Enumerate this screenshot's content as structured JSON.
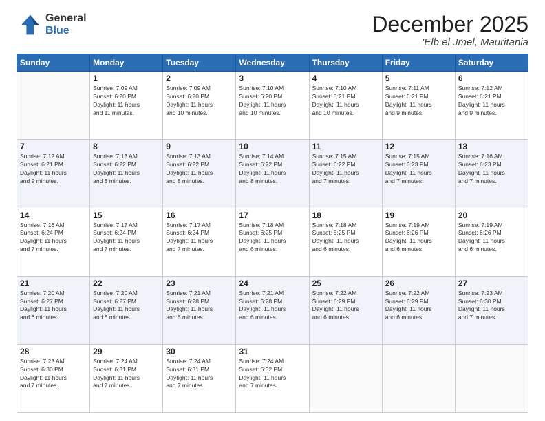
{
  "logo": {
    "general": "General",
    "blue": "Blue"
  },
  "title": "December 2025",
  "location": "'Elb el Jmel, Mauritania",
  "days_of_week": [
    "Sunday",
    "Monday",
    "Tuesday",
    "Wednesday",
    "Thursday",
    "Friday",
    "Saturday"
  ],
  "weeks": [
    [
      {
        "day": "",
        "info": ""
      },
      {
        "day": "1",
        "info": "Sunrise: 7:09 AM\nSunset: 6:20 PM\nDaylight: 11 hours\nand 11 minutes."
      },
      {
        "day": "2",
        "info": "Sunrise: 7:09 AM\nSunset: 6:20 PM\nDaylight: 11 hours\nand 10 minutes."
      },
      {
        "day": "3",
        "info": "Sunrise: 7:10 AM\nSunset: 6:20 PM\nDaylight: 11 hours\nand 10 minutes."
      },
      {
        "day": "4",
        "info": "Sunrise: 7:10 AM\nSunset: 6:21 PM\nDaylight: 11 hours\nand 10 minutes."
      },
      {
        "day": "5",
        "info": "Sunrise: 7:11 AM\nSunset: 6:21 PM\nDaylight: 11 hours\nand 9 minutes."
      },
      {
        "day": "6",
        "info": "Sunrise: 7:12 AM\nSunset: 6:21 PM\nDaylight: 11 hours\nand 9 minutes."
      }
    ],
    [
      {
        "day": "7",
        "info": "Sunrise: 7:12 AM\nSunset: 6:21 PM\nDaylight: 11 hours\nand 9 minutes."
      },
      {
        "day": "8",
        "info": "Sunrise: 7:13 AM\nSunset: 6:22 PM\nDaylight: 11 hours\nand 8 minutes."
      },
      {
        "day": "9",
        "info": "Sunrise: 7:13 AM\nSunset: 6:22 PM\nDaylight: 11 hours\nand 8 minutes."
      },
      {
        "day": "10",
        "info": "Sunrise: 7:14 AM\nSunset: 6:22 PM\nDaylight: 11 hours\nand 8 minutes."
      },
      {
        "day": "11",
        "info": "Sunrise: 7:15 AM\nSunset: 6:22 PM\nDaylight: 11 hours\nand 7 minutes."
      },
      {
        "day": "12",
        "info": "Sunrise: 7:15 AM\nSunset: 6:23 PM\nDaylight: 11 hours\nand 7 minutes."
      },
      {
        "day": "13",
        "info": "Sunrise: 7:16 AM\nSunset: 6:23 PM\nDaylight: 11 hours\nand 7 minutes."
      }
    ],
    [
      {
        "day": "14",
        "info": "Sunrise: 7:16 AM\nSunset: 6:24 PM\nDaylight: 11 hours\nand 7 minutes."
      },
      {
        "day": "15",
        "info": "Sunrise: 7:17 AM\nSunset: 6:24 PM\nDaylight: 11 hours\nand 7 minutes."
      },
      {
        "day": "16",
        "info": "Sunrise: 7:17 AM\nSunset: 6:24 PM\nDaylight: 11 hours\nand 7 minutes."
      },
      {
        "day": "17",
        "info": "Sunrise: 7:18 AM\nSunset: 6:25 PM\nDaylight: 11 hours\nand 6 minutes."
      },
      {
        "day": "18",
        "info": "Sunrise: 7:18 AM\nSunset: 6:25 PM\nDaylight: 11 hours\nand 6 minutes."
      },
      {
        "day": "19",
        "info": "Sunrise: 7:19 AM\nSunset: 6:26 PM\nDaylight: 11 hours\nand 6 minutes."
      },
      {
        "day": "20",
        "info": "Sunrise: 7:19 AM\nSunset: 6:26 PM\nDaylight: 11 hours\nand 6 minutes."
      }
    ],
    [
      {
        "day": "21",
        "info": "Sunrise: 7:20 AM\nSunset: 6:27 PM\nDaylight: 11 hours\nand 6 minutes."
      },
      {
        "day": "22",
        "info": "Sunrise: 7:20 AM\nSunset: 6:27 PM\nDaylight: 11 hours\nand 6 minutes."
      },
      {
        "day": "23",
        "info": "Sunrise: 7:21 AM\nSunset: 6:28 PM\nDaylight: 11 hours\nand 6 minutes."
      },
      {
        "day": "24",
        "info": "Sunrise: 7:21 AM\nSunset: 6:28 PM\nDaylight: 11 hours\nand 6 minutes."
      },
      {
        "day": "25",
        "info": "Sunrise: 7:22 AM\nSunset: 6:29 PM\nDaylight: 11 hours\nand 6 minutes."
      },
      {
        "day": "26",
        "info": "Sunrise: 7:22 AM\nSunset: 6:29 PM\nDaylight: 11 hours\nand 6 minutes."
      },
      {
        "day": "27",
        "info": "Sunrise: 7:23 AM\nSunset: 6:30 PM\nDaylight: 11 hours\nand 7 minutes."
      }
    ],
    [
      {
        "day": "28",
        "info": "Sunrise: 7:23 AM\nSunset: 6:30 PM\nDaylight: 11 hours\nand 7 minutes."
      },
      {
        "day": "29",
        "info": "Sunrise: 7:24 AM\nSunset: 6:31 PM\nDaylight: 11 hours\nand 7 minutes."
      },
      {
        "day": "30",
        "info": "Sunrise: 7:24 AM\nSunset: 6:31 PM\nDaylight: 11 hours\nand 7 minutes."
      },
      {
        "day": "31",
        "info": "Sunrise: 7:24 AM\nSunset: 6:32 PM\nDaylight: 11 hours\nand 7 minutes."
      },
      {
        "day": "",
        "info": ""
      },
      {
        "day": "",
        "info": ""
      },
      {
        "day": "",
        "info": ""
      }
    ]
  ]
}
